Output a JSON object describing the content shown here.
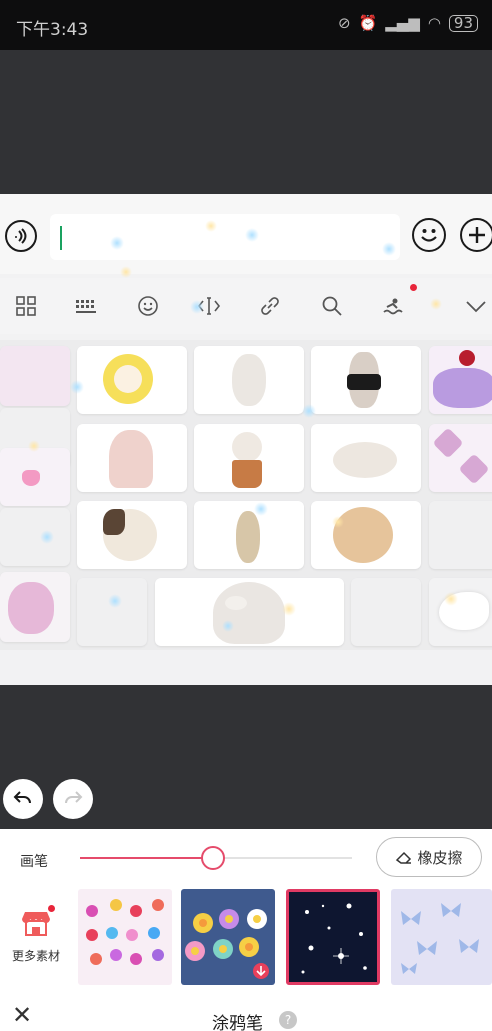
{
  "status_bar": {
    "time": "下午3:43",
    "battery": "93",
    "icons": [
      "alarm-off-icon",
      "alarm-icon",
      "signal-icon",
      "wifi-icon"
    ]
  },
  "keyboard_preview": {
    "toolbar_icons": [
      "apps-grid-icon",
      "keyboard-icon",
      "smiley-icon",
      "text-cursor-icon",
      "link-icon",
      "search-icon",
      "theme-swim-icon",
      "collapse-chevron-icon"
    ]
  },
  "editor": {
    "brush_label": "画笔",
    "brush_size": 0.49,
    "eraser_label": "橡皮擦",
    "more_materials_label": "更多素材",
    "title": "涂鸦笔",
    "help_glyph": "?"
  },
  "colors": {
    "accent": "#e54b6b",
    "selected_border": "#e03a63",
    "canvas_bg": "#313235"
  }
}
